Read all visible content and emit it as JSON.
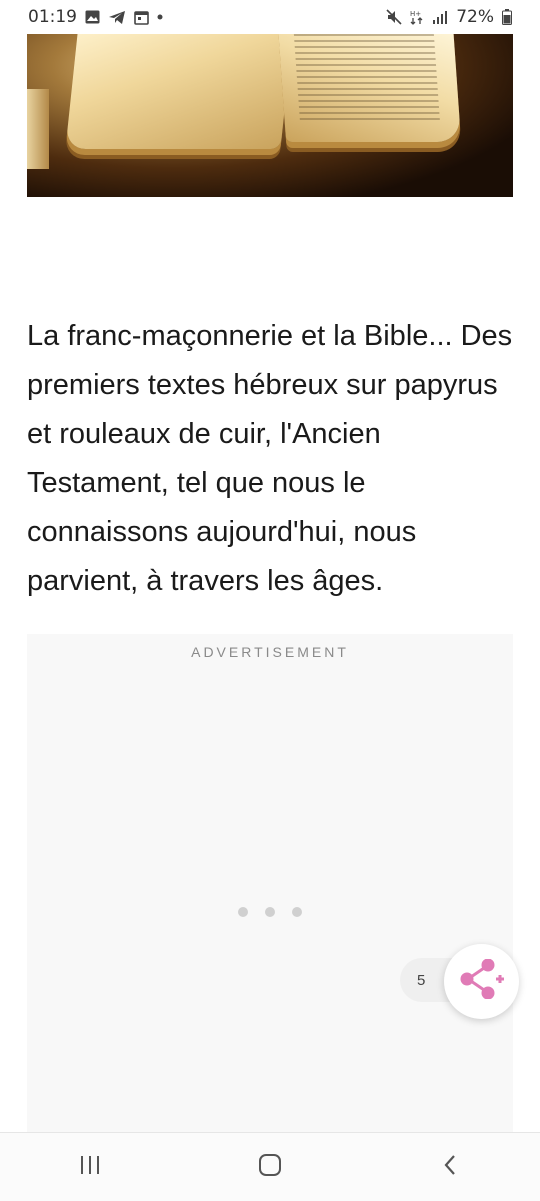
{
  "status_bar": {
    "time": "01:19",
    "battery": "72%",
    "left_icons": [
      "image-icon",
      "telegram-icon",
      "calendar-icon",
      "dot-icon"
    ],
    "right_icons": [
      "mute-icon",
      "data-arrows-icon",
      "signal-icon",
      "battery-icon"
    ]
  },
  "article": {
    "hero_image": "open-bible-photo",
    "paragraph": "La franc-maçonnerie et la Bible... Des premiers textes hébreux sur papyrus et rouleaux de cuir, l'Ancien Testament, tel que nous le connaissons aujourd'hui, nous parvient, à travers les âges."
  },
  "ad": {
    "label": "ADVERTISEMENT"
  },
  "share": {
    "count": "5",
    "color": "#e07bb6"
  },
  "nav": {
    "buttons": [
      "recent-apps",
      "home",
      "back"
    ]
  }
}
